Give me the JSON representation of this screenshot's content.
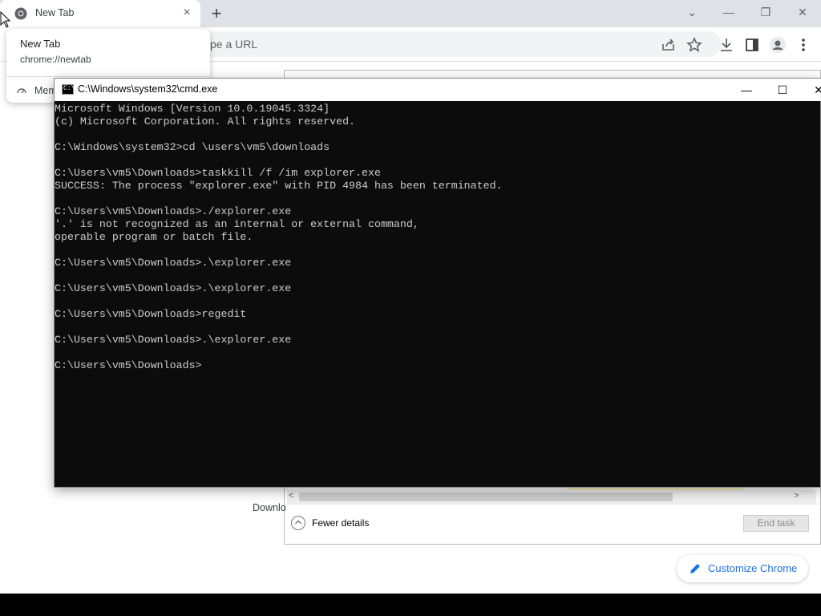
{
  "browser": {
    "tab": {
      "title": "New Tab",
      "close_icon": "×"
    },
    "new_tab_icon": "+",
    "window_controls": {
      "dropdown": "⌄",
      "minimize": "—",
      "restore": "❐",
      "close": "✕"
    },
    "omnibox": {
      "placeholder_partial": "pe a URL"
    },
    "toolbar_icons": [
      "share-icon",
      "star-icon",
      "download-icon",
      "side-panel-icon",
      "profile-icon",
      "menu-icon"
    ]
  },
  "hovercard": {
    "title": "New Tab",
    "url": "chrome://newtab",
    "memory_text": "Mem"
  },
  "taskmanager": {
    "fewer_details": "Fewer details",
    "end_task": "End task",
    "scroll_left": "<",
    "scroll_right": ">"
  },
  "newtab_page": {
    "download_partial": "Downlo",
    "customize_label": "Customize Chrome"
  },
  "cmd": {
    "title": "C:\\Windows\\system32\\cmd.exe",
    "icon_text": "C:\\",
    "controls": {
      "minimize": "—",
      "maximize": "☐",
      "close": "✕"
    },
    "output": "Microsoft Windows [Version 10.0.19045.3324]\n(c) Microsoft Corporation. All rights reserved.\n\nC:\\Windows\\system32>cd \\users\\vm5\\downloads\n\nC:\\Users\\vm5\\Downloads>taskkill /f /im explorer.exe\nSUCCESS: The process \"explorer.exe\" with PID 4984 has been terminated.\n\nC:\\Users\\vm5\\Downloads>./explorer.exe\n'.' is not recognized as an internal or external command,\noperable program or batch file.\n\nC:\\Users\\vm5\\Downloads>.\\explorer.exe\n\nC:\\Users\\vm5\\Downloads>.\\explorer.exe\n\nC:\\Users\\vm5\\Downloads>regedit\n\nC:\\Users\\vm5\\Downloads>.\\explorer.exe\n\nC:\\Users\\vm5\\Downloads>"
  },
  "colors": {
    "chrome_tabstrip": "#dee1e6",
    "console_bg": "#0c0c0c",
    "console_text": "#cccccc",
    "accent_blue": "#1a73e8"
  }
}
